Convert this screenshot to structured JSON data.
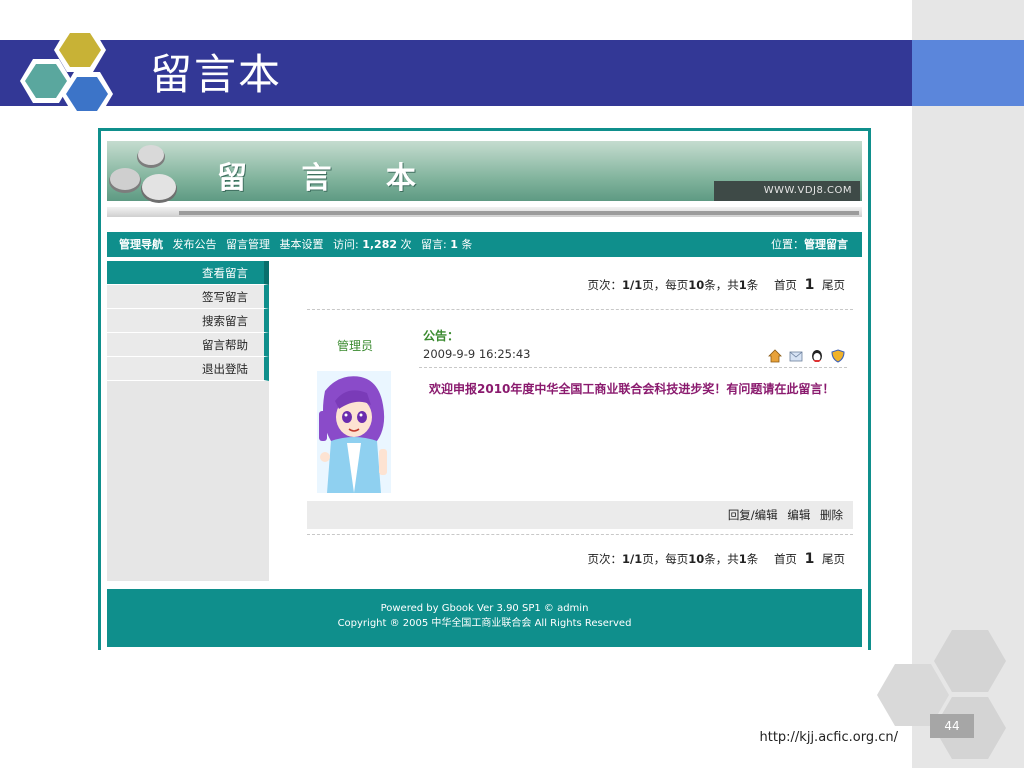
{
  "slide": {
    "title": "留言本",
    "page_number": "44",
    "footer_url": "http://kjj.acfic.org.cn/"
  },
  "colors": {
    "banner": "#333896",
    "teal": "#0f8f8c",
    "accent_blue": "#5b86db",
    "right_panel": "#e6e6e6"
  },
  "guestbook": {
    "header": {
      "title": "留 言 本",
      "url": "WWW.VDJ8.COM"
    },
    "nav": {
      "items": [
        "管理导航",
        "发布公告",
        "留言管理",
        "基本设置"
      ],
      "visits_label": "访问:",
      "visits_count": "1,282",
      "visits_unit": "次",
      "messages_label": "留言:",
      "messages_count": "1",
      "messages_unit": "条",
      "location_label": "位置：",
      "location_value": "管理留言"
    },
    "sidebar": {
      "items": [
        {
          "label": "查看留言",
          "active": true
        },
        {
          "label": "签写留言",
          "active": false
        },
        {
          "label": "搜索留言",
          "active": false
        },
        {
          "label": "留言帮助",
          "active": false
        },
        {
          "label": "退出登陆",
          "active": false
        }
      ]
    },
    "pager": {
      "label": "页次：",
      "current": "1/1",
      "page_unit": "页，每页",
      "per_page": "10",
      "per_page_unit": "条，共",
      "total": "1",
      "total_unit": "条",
      "first": "首页",
      "page": "1",
      "last": "尾页"
    },
    "post": {
      "author": "管理员",
      "label": "公告：",
      "date": "2009-9-9 16:25:43",
      "icons": [
        "home-icon",
        "email-icon",
        "qq-icon",
        "shield-icon"
      ],
      "body": "欢迎申报2010年度中华全国工商业联合会科技进步奖！有问题请在此留言！",
      "actions": [
        "回复/编辑",
        "编辑",
        "删除"
      ]
    },
    "footer": {
      "line1": "Powered by Gbook Ver 3.90 SP1 © admin",
      "line2": "Copyright ® 2005 中华全国工商业联合会  All Rights Reserved"
    }
  }
}
